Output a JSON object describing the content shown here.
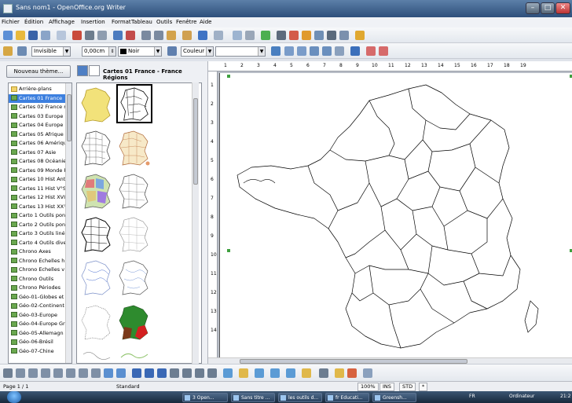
{
  "window": {
    "title": "Sans nom1 - OpenOffice.org Writer",
    "controls": {
      "minimize": "–",
      "maximize": "□",
      "close": "✕"
    }
  },
  "menu": [
    "Fichier",
    "Édition",
    "Affichage",
    "Insertion",
    "Format",
    "Tableau",
    "Outils",
    "Fenêtre",
    "Aide"
  ],
  "toolbar2": {
    "line_style": "Invisible",
    "line_width": "0,00cm",
    "line_color": "Noir",
    "area_style": "Couleur",
    "area_fill": ""
  },
  "gallery": {
    "new_theme_button": "Nouveau thème...",
    "caption": "Cartes 01 France  - France Régions",
    "themes": [
      "Arrière-plans",
      "Cartes 01 France",
      "Cartes 02 France re",
      "Cartes 03 Europe",
      "Cartes 04 Europe E",
      "Cartes 05 Afrique",
      "Cartes 06 Amériqu",
      "Cartes 07 Asie",
      "Cartes 08 Océanie",
      "Cartes 09 Monde F",
      "Cartes 10 Hist Anti",
      "Cartes 11  Hist V°S",
      "Cartes 12 Hist XVI°",
      "Cartes 13 Hist XX°",
      "Carto 1 Outils pon",
      "Carto 2 Outils pon",
      "Carto 3 Outils  liné",
      "Carto 4 Outils dive",
      "Chrono Axes",
      "Chrono Echelles h",
      "Chrono Echelles v",
      "Chrono Outils",
      "Chrono Périodes",
      "Géo-01-Globes et",
      "Géo-02-Continent",
      "Géo-03-Europe",
      "Géo-04-Europe Gr",
      "Géo-05-Allemagn",
      "Géo-06-Brésil",
      "Géo-07-Chine"
    ],
    "selected_theme": "Cartes 01 France"
  },
  "ruler": {
    "h": [
      "1",
      "2",
      "3",
      "4",
      "5",
      "6",
      "7",
      "8",
      "9",
      "10",
      "11",
      "12",
      "13",
      "14",
      "15",
      "16",
      "17",
      "18",
      "19"
    ],
    "v": [
      "1",
      "2",
      "3",
      "4",
      "5",
      "6",
      "7",
      "8",
      "9",
      "10",
      "11",
      "12",
      "13",
      "14"
    ]
  },
  "status": {
    "page": "Page 1 / 1",
    "style": "Standard",
    "zoom": "100%",
    "mode_ins": "INS",
    "mode_std": "STD",
    "modified": "*"
  },
  "taskbar": {
    "tasks": [
      "3 Open...",
      "Sans titre ...",
      "les outils d...",
      "fr Educati...",
      "Greensh..."
    ],
    "lang": "FR",
    "computer": "Ordinateur",
    "clock": "21:2"
  },
  "colors": {
    "selection": "#3d80df",
    "map_yellow": "#f2e27a",
    "map_green": "#2e8b2e",
    "map_red": "#d32020"
  }
}
